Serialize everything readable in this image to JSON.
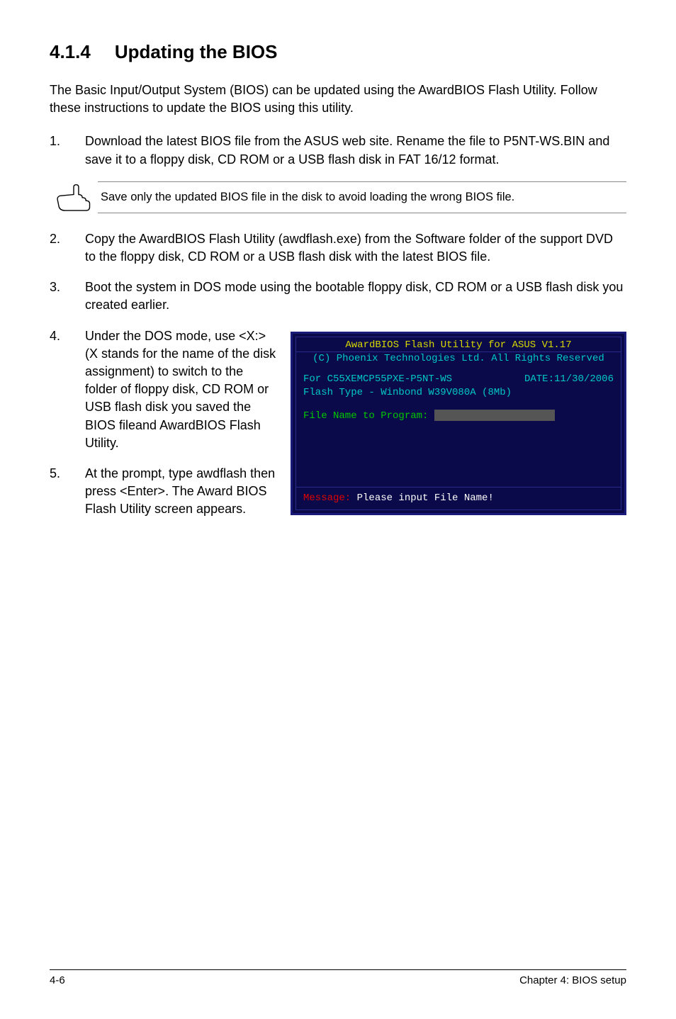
{
  "heading": {
    "num": "4.1.4",
    "title": "Updating the BIOS"
  },
  "intro": "The Basic Input/Output System (BIOS) can be updated using the AwardBIOS Flash Utility. Follow these instructions to update the BIOS using this utility.",
  "steps1": [
    {
      "num": "1.",
      "text": "Download the latest BIOS file from the ASUS web site. Rename the file to P5NT-WS.BIN and save it to a floppy disk, CD ROM or a USB flash disk in FAT 16/12 format."
    }
  ],
  "note": "Save only the updated BIOS file in the disk to avoid loading the wrong BIOS file.",
  "steps2": [
    {
      "num": "2.",
      "text": "Copy the AwardBIOS Flash Utility (awdflash.exe) from the Software folder of the support DVD to the floppy disk, CD ROM or a USB flash disk with the latest BIOS file."
    },
    {
      "num": "3.",
      "text": "Boot the system in DOS mode using the bootable floppy disk, CD ROM or a USB flash disk you created earlier."
    }
  ],
  "steps3": [
    {
      "num": "4.",
      "text": "Under the DOS mode, use <X:> (X stands for the name of the disk assignment) to switch to the folder of floppy disk, CD ROM or USB flash disk you saved the BIOS fileand AwardBIOS Flash Utility."
    },
    {
      "num": "5.",
      "text": "At the prompt, type awdflash then press <Enter>. The Award BIOS Flash Utility screen appears."
    }
  ],
  "screenshot": {
    "header1": "AwardBIOS Flash Utility for ASUS V1.17",
    "header2": "(C) Phoenix Technologies Ltd. All Rights Reserved",
    "for_line_left": "For C55XEMCP55PXE-P5NT-WS",
    "for_line_right": "DATE:11/30/2006",
    "flash_type": "Flash Type - Winbond W39V080A (8Mb)",
    "file_prompt": "File Name to Program:",
    "message_label": "Message:",
    "message_text": " Please input File Name!"
  },
  "footer": {
    "left": "4-6",
    "right": "Chapter 4: BIOS setup"
  }
}
